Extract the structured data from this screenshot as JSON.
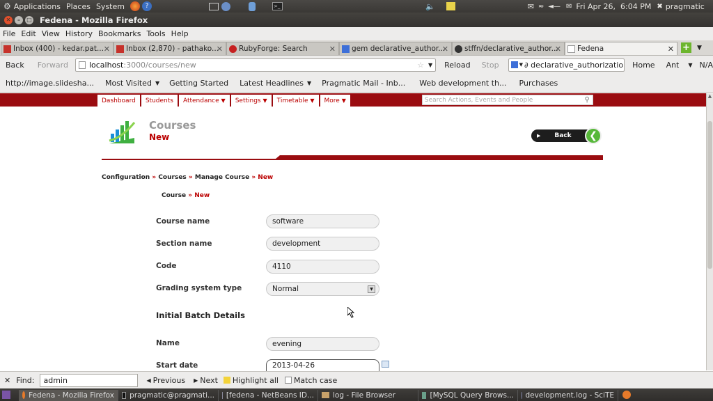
{
  "panel": {
    "menus": [
      "Applications",
      "Places",
      "System"
    ],
    "datetime": "Fri Apr 26,  6:04 PM",
    "user": "pragmatic"
  },
  "window": {
    "title": "Fedena - Mozilla Firefox"
  },
  "menubar": [
    "File",
    "Edit",
    "View",
    "History",
    "Bookmarks",
    "Tools",
    "Help"
  ],
  "tabs": [
    {
      "label": "Inbox (400) - kedar.pat...",
      "active": false
    },
    {
      "label": "Inbox (2,870) - pathako...",
      "active": false
    },
    {
      "label": "RubyForge: Search",
      "active": false
    },
    {
      "label": "gem declarative_author...",
      "active": false
    },
    {
      "label": "stffn/declarative_author...",
      "active": false
    },
    {
      "label": "Fedena",
      "active": true
    }
  ],
  "nav": {
    "back": "Back",
    "forward": "Forward",
    "url_host": "localhost",
    "url_rest": ":3000/courses/new",
    "reload": "Reload",
    "stop": "Stop",
    "search_value": "∂ declarative_authorization",
    "home": "Home",
    "ant": "Ant",
    "na": "N/A"
  },
  "bookmarks": [
    "http://image.slidesha...",
    "Most Visited",
    "Getting Started",
    "Latest Headlines",
    "Pragmatic Mail - Inb...",
    "Web development th...",
    "Purchases"
  ],
  "site": {
    "nav": [
      "Dashboard",
      "Students",
      "Attendance",
      "Settings",
      "Timetable",
      "More"
    ],
    "search_placeholder": "Search Actions, Events and People",
    "heading": "Courses",
    "subheading": "New",
    "back_button": "Back",
    "breadcrumb": [
      "Configuration",
      "Courses",
      "Manage Course",
      "New"
    ],
    "sep": "»",
    "sub_crumb": [
      "Course",
      "New"
    ],
    "fields": [
      {
        "label": "Course name",
        "value": "software"
      },
      {
        "label": "Section name",
        "value": "development"
      },
      {
        "label": "Code",
        "value": "4110"
      }
    ],
    "grading_label": "Grading system type",
    "grading_value": "Normal",
    "batch_heading": "Initial Batch Details",
    "batch_name_label": "Name",
    "batch_name_value": "evening",
    "start_date_label": "Start date",
    "start_date_value": "2013-04-26"
  },
  "findbar": {
    "label": "Find:",
    "value": "admin",
    "previous": "Previous",
    "next": "Next",
    "highlight": "Highlight all",
    "match_case": "Match case"
  },
  "taskbar": [
    {
      "label": "Fedena - Mozilla Firefox",
      "active": true
    },
    {
      "label": "pragmatic@pragmati...",
      "active": false
    },
    {
      "label": "[fedena - NetBeans ID...",
      "active": false
    },
    {
      "label": "log - File Browser",
      "active": false
    },
    {
      "label": "[MySQL Query Brows...",
      "active": false
    },
    {
      "label": "development.log - SciTE",
      "active": false
    }
  ],
  "colors": {
    "brand_red": "#9a0c10",
    "accent_red": "#b00000",
    "green": "#3fb041"
  }
}
